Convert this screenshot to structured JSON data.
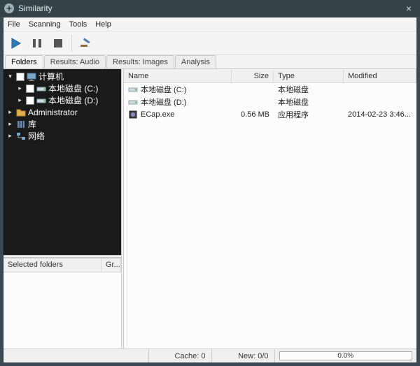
{
  "window": {
    "title": "Similarity"
  },
  "menu": {
    "file": "File",
    "scanning": "Scanning",
    "tools": "Tools",
    "help": "Help"
  },
  "tabs": {
    "folders": "Folders",
    "results_audio": "Results: Audio",
    "results_images": "Results: Images",
    "analysis": "Analysis"
  },
  "tree": {
    "computer": "计算机",
    "drive_c": "本地磁盘 (C:)",
    "drive_d": "本地磁盘 (D:)",
    "administrator": "Administrator",
    "libraries": "库",
    "network": "网络"
  },
  "selected_folders": {
    "col1": "Selected folders",
    "col2": "Gr..."
  },
  "list": {
    "head": {
      "name": "Name",
      "size": "Size",
      "type": "Type",
      "modified": "Modified"
    },
    "rows": [
      {
        "name": "本地磁盘 (C:)",
        "size": "",
        "type": "本地磁盘",
        "modified": "",
        "icon": "drive"
      },
      {
        "name": "本地磁盘 (D:)",
        "size": "",
        "type": "本地磁盘",
        "modified": "",
        "icon": "drive"
      },
      {
        "name": "ECap.exe",
        "size": "0.56 MB",
        "type": "应用程序",
        "modified": "2014-02-23 3:46...",
        "icon": "exe"
      }
    ]
  },
  "status": {
    "cache": "Cache: 0",
    "new": "New: 0/0",
    "progress": "0.0%"
  }
}
